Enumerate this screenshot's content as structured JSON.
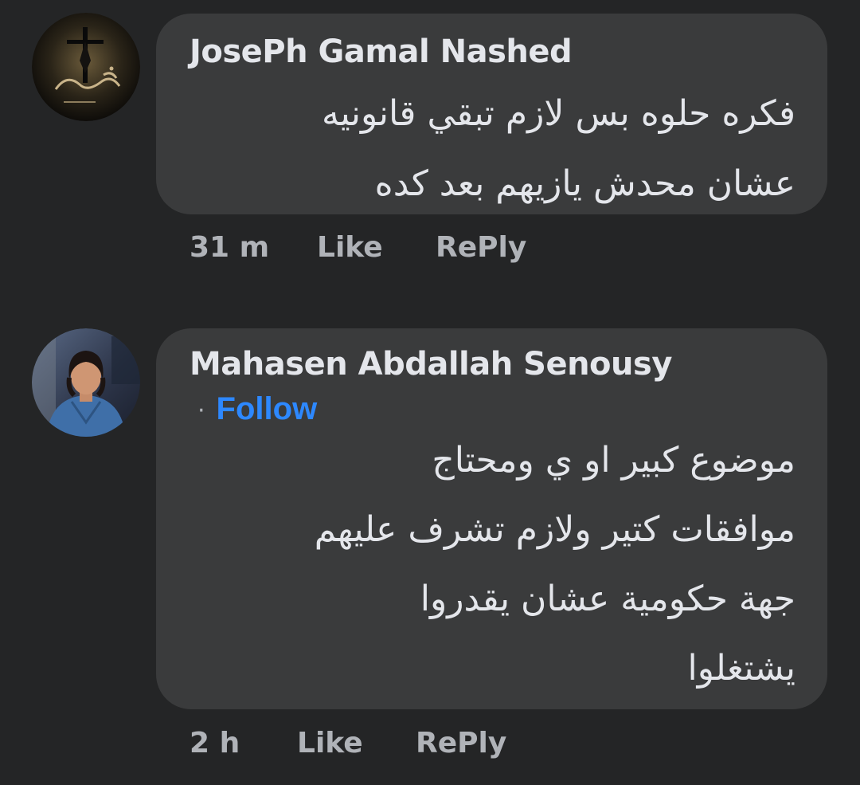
{
  "comments": [
    {
      "author": "JosePh Gamal Nashed",
      "avatar_icon": "crucifix-avatar-icon",
      "body_lines": [
        "فكره حلوه بس لازم تبقي قانونيه",
        "عشان محدش يازيهم بعد كده"
      ],
      "timestamp": "31 m",
      "like_label": "Like",
      "reply_label": "RePly"
    },
    {
      "author": "Mahasen Abdallah Senousy",
      "avatar_icon": "woman-portrait-avatar-icon",
      "follow_dot": "·",
      "follow_label": "Follow",
      "body_lines": [
        "موضوع كبير او ي ومحتاج",
        "موافقات كتير ولازم تشرف عليهم",
        "جهة حكومية عشان يقدروا",
        "يشتغلوا"
      ],
      "timestamp": "2 h",
      "like_label": "Like",
      "reply_label": "RePly"
    }
  ],
  "colors": {
    "background": "#242526",
    "bubble": "#3a3b3c",
    "text": "#e4e6eb",
    "secondary_text": "#b0b3b8",
    "link": "#2d88ff"
  }
}
